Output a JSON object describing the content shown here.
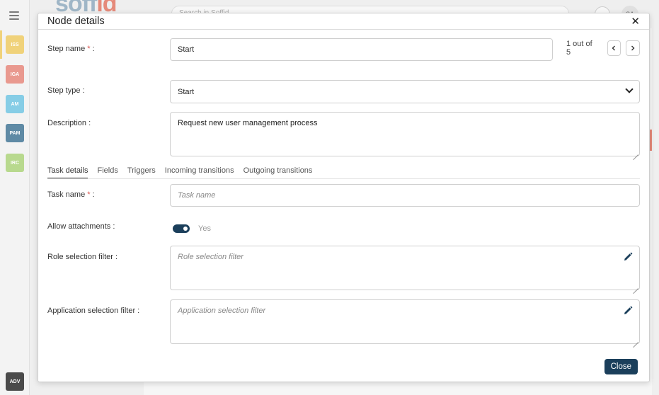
{
  "background": {
    "logo_text": "soff",
    "logo_dot": "id",
    "search_placeholder": "Search in Soffid",
    "help_icon": "?",
    "avatar_initials": "SA",
    "modules": [
      {
        "label": "ISS",
        "color": "#f0d27a"
      },
      {
        "label": "IGA",
        "color": "#e9998f"
      },
      {
        "label": "AM",
        "color": "#86cde6"
      },
      {
        "label": "PAM",
        "color": "#5f8aa5"
      },
      {
        "label": "IRC",
        "color": "#b8d98e"
      },
      {
        "label": "ADV",
        "color": "#4a4a4a"
      }
    ]
  },
  "modal": {
    "title": "Node details",
    "close_icon": "✕",
    "step_name": {
      "label": "Step name",
      "required_mark": "*",
      "suffix": " :",
      "value": "Start"
    },
    "pager": {
      "text": "1 out of 5",
      "prev_icon": "‹",
      "next_icon": "›"
    },
    "step_type": {
      "label": "Step type :",
      "value": "Start"
    },
    "description": {
      "label": "Description :",
      "value": "Request new user management process"
    },
    "tabs": [
      {
        "label": "Task details",
        "active": true
      },
      {
        "label": "Fields",
        "active": false
      },
      {
        "label": "Triggers",
        "active": false
      },
      {
        "label": "Incoming transitions",
        "active": false
      },
      {
        "label": "Outgoing transitions",
        "active": false
      }
    ],
    "task_name": {
      "label": "Task name",
      "required_mark": "*",
      "suffix": " :",
      "placeholder": "Task name"
    },
    "allow_attachments": {
      "label": "Allow attachments :",
      "value": "Yes",
      "checked": true
    },
    "role_filter": {
      "label": "Role selection filter :",
      "placeholder": "Role selection filter"
    },
    "app_filter": {
      "label": "Application selection filter :",
      "placeholder": "Application selection filter"
    },
    "close_button": "Close"
  },
  "colors": {
    "primary": "#1b3f5b",
    "required": "#d9534f"
  }
}
